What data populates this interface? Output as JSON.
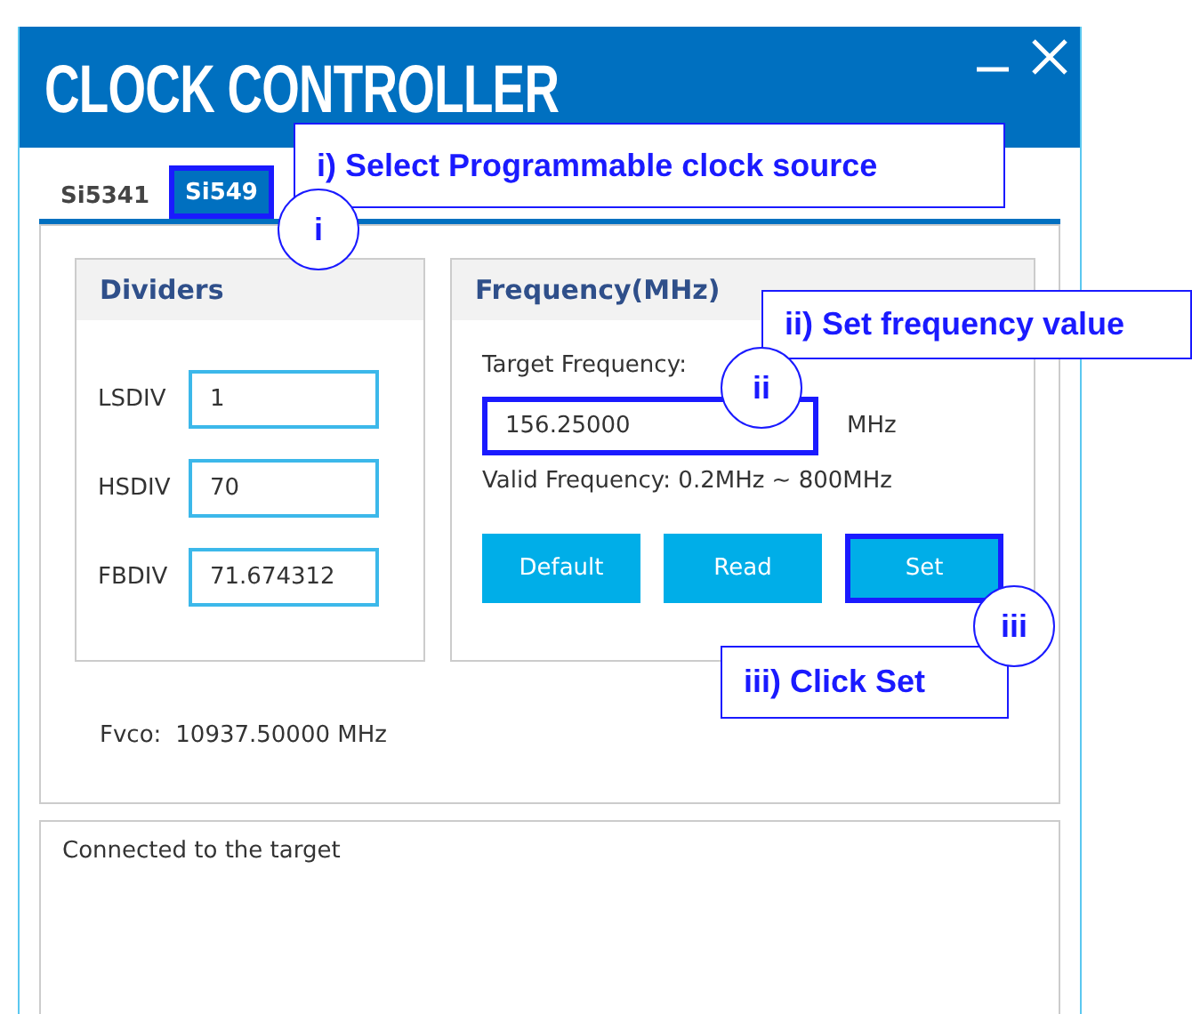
{
  "window": {
    "title": "CLOCK CONTROLLER"
  },
  "tabs": [
    {
      "label": "Si5341",
      "selected": false
    },
    {
      "label": "Si549",
      "selected": true
    }
  ],
  "dividers": {
    "title": "Dividers",
    "fields": [
      {
        "label": "LSDIV",
        "value": "1"
      },
      {
        "label": "HSDIV",
        "value": "70"
      },
      {
        "label": "FBDIV",
        "value": "71.674312"
      }
    ]
  },
  "fvco": {
    "label": "Fvco:",
    "value": "10937.50000 MHz"
  },
  "frequency": {
    "title": "Frequency(MHz)",
    "target_label": "Target Frequency:",
    "target_value": "156.25000",
    "target_highlighted": true,
    "unit": "MHz",
    "valid_range": "Valid Frequency: 0.2MHz ~ 800MHz",
    "buttons": [
      {
        "label": "Default",
        "highlighted": false
      },
      {
        "label": "Read",
        "highlighted": false
      },
      {
        "label": "Set",
        "highlighted": true
      }
    ]
  },
  "log": [
    "Connected to the target"
  ],
  "annotations": [
    {
      "text": "i) Select Programmable clock source",
      "marker": "i"
    },
    {
      "text": "ii) Set frequency value",
      "marker": "ii"
    },
    {
      "text": "iii) Click Set",
      "marker": "iii"
    }
  ]
}
